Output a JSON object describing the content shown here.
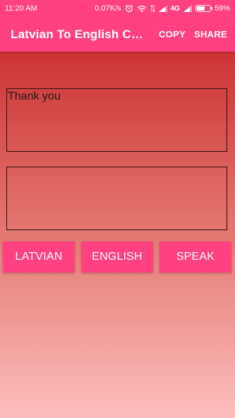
{
  "status_bar": {
    "time": "11:20 AM",
    "network_speed": "0.07K/s",
    "network_type": "4G",
    "battery_percent": "59%",
    "battery_level": 0.59,
    "icons": [
      "alarm-icon",
      "wifi-icon",
      "data-arrows-icon",
      "signal-icon",
      "signal-icon",
      "battery-icon"
    ]
  },
  "app_bar": {
    "title": "Latvian To English Co...",
    "copy_label": "COPY",
    "share_label": "SHARE",
    "background_color": "#ff4081"
  },
  "main": {
    "input_text": "Thank you",
    "output_text": "",
    "buttons": {
      "latvian": "LATVIAN",
      "english": "ENGLISH",
      "speak": "SPEAK"
    },
    "gradient_colors": [
      "#cc3333",
      "#e3766f",
      "#fdbfbd"
    ]
  }
}
